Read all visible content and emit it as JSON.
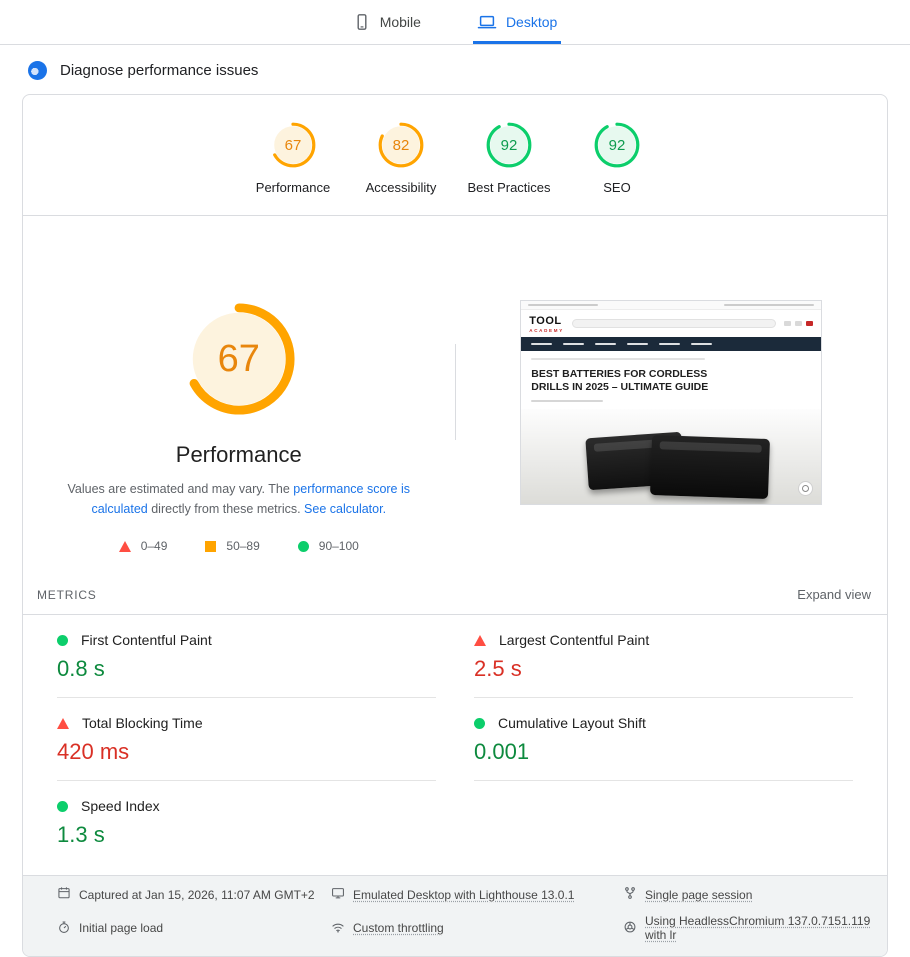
{
  "tabs": {
    "mobile": "Mobile",
    "desktop": "Desktop"
  },
  "header": {
    "title": "Diagnose performance issues"
  },
  "scores": [
    {
      "label": "Performance",
      "value": 67
    },
    {
      "label": "Accessibility",
      "value": 82
    },
    {
      "label": "Best Practices",
      "value": 92
    },
    {
      "label": "SEO",
      "value": 92
    }
  ],
  "gauge": {
    "value": 67,
    "title": "Performance",
    "desc_pre": "Values are estimated and may vary. The ",
    "desc_link1": "performance score is calculated",
    "desc_mid": " directly from these metrics. ",
    "desc_link2": "See calculator.",
    "legend": [
      {
        "label": "0–49",
        "level": "poor"
      },
      {
        "label": "50–89",
        "level": "average"
      },
      {
        "label": "90–100",
        "level": "good"
      }
    ]
  },
  "metrics": {
    "heading": "METRICS",
    "expand_label": "Expand view",
    "items": [
      {
        "name": "First Contentful Paint",
        "value": "0.8 s",
        "level": "good"
      },
      {
        "name": "Largest Contentful Paint",
        "value": "2.5 s",
        "level": "poor"
      },
      {
        "name": "Total Blocking Time",
        "value": "420 ms",
        "level": "poor"
      },
      {
        "name": "Cumulative Layout Shift",
        "value": "0.001",
        "level": "good"
      },
      {
        "name": "Speed Index",
        "value": "1.3 s",
        "level": "good"
      }
    ]
  },
  "screenshot": {
    "logo_top": "TOOL",
    "logo_bottom": "ACADEMY",
    "headline": "BEST BATTERIES FOR CORDLESS DRILLS IN 2025 – ULTIMATE GUIDE"
  },
  "footer": {
    "items": [
      {
        "label": "Captured at Jan 15, 2026, 11:07 AM GMT+2",
        "icon": "calendar-icon"
      },
      {
        "label": "Emulated Desktop with Lighthouse 13.0.1",
        "icon": "monitor-icon"
      },
      {
        "label": "Single page session",
        "icon": "session-fork-icon"
      },
      {
        "label": "Initial page load",
        "icon": "stopwatch-icon"
      },
      {
        "label": "Custom throttling",
        "icon": "wifi-icon"
      },
      {
        "label": "Using HeadlessChromium 137.0.7151.119 with lr",
        "icon": "globe-icon"
      }
    ]
  },
  "colors": {
    "good": "#0cce6b",
    "average": "#ffa400",
    "poor": "#ff4e42",
    "good_text": "#0d8a3e",
    "average_text": "#e8860c",
    "poor_text": "#d93025",
    "accent": "#1a73e8"
  }
}
